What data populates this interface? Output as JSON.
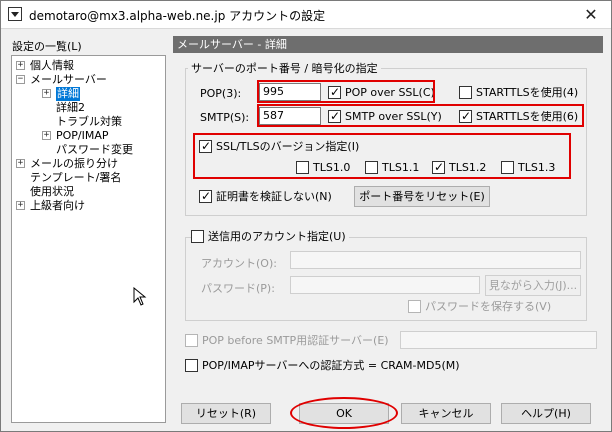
{
  "window": {
    "title": "demotaro@mx3.alpha-web.ne.jp アカウントの設定",
    "close_glyph": "✕"
  },
  "sidebar": {
    "label": "設定の一覧(L)",
    "items": [
      {
        "label": "個人情報",
        "expander": "+"
      },
      {
        "label": "メールサーバー",
        "expander": "−"
      },
      {
        "label": "詳細",
        "expander": "+"
      },
      {
        "label": "詳細2"
      },
      {
        "label": "トラブル対策"
      },
      {
        "label": "POP/IMAP",
        "expander": "+"
      },
      {
        "label": "パスワード変更"
      },
      {
        "label": "メールの振り分け",
        "expander": "+"
      },
      {
        "label": "テンプレート/署名"
      },
      {
        "label": "使用状況"
      },
      {
        "label": "上級者向け",
        "expander": "+"
      }
    ]
  },
  "panel": {
    "header": "メールサーバー - 詳細",
    "ports_group": "サーバーのポート番号 / 暗号化の指定",
    "pop_label": "POP(3):",
    "pop_value": "995",
    "pop_ssl_label": "POP over SSL(C)",
    "pop_starttls_label": "STARTTLSを使用(4)",
    "smtp_label": "SMTP(S):",
    "smtp_value": "587",
    "smtp_ssl_label": "SMTP over SSL(Y)",
    "smtp_starttls_label": "STARTTLSを使用(6)",
    "tls_version_label": "SSL/TLSのバージョン指定(I)",
    "tls": [
      "TLS1.0",
      "TLS1.1",
      "TLS1.2",
      "TLS1.3"
    ],
    "no_verify_label": "証明書を検証しない(N)",
    "reset_port_button": "ポート番号をリセット(E)",
    "send_account_label": "送信用のアカウント指定(U)",
    "account_label": "アカウント(O):",
    "password_label": "パスワード(P):",
    "show_password_button": "見ながら入力(J)...",
    "save_password_label": "パスワードを保存する(V)",
    "pop_before_smtp_label": "POP before SMTP用認証サーバー(E)",
    "auth_method_label": "POP/IMAPサーバーへの認証方式 = CRAM-MD5(M)"
  },
  "buttons": {
    "reset": "リセット(R)",
    "ok": "OK",
    "cancel": "キャンセル",
    "help": "ヘルプ(H)"
  },
  "colors": {
    "highlight": "#e00000",
    "selection": "#0078d7",
    "header_bg": "#6e6e6e"
  }
}
